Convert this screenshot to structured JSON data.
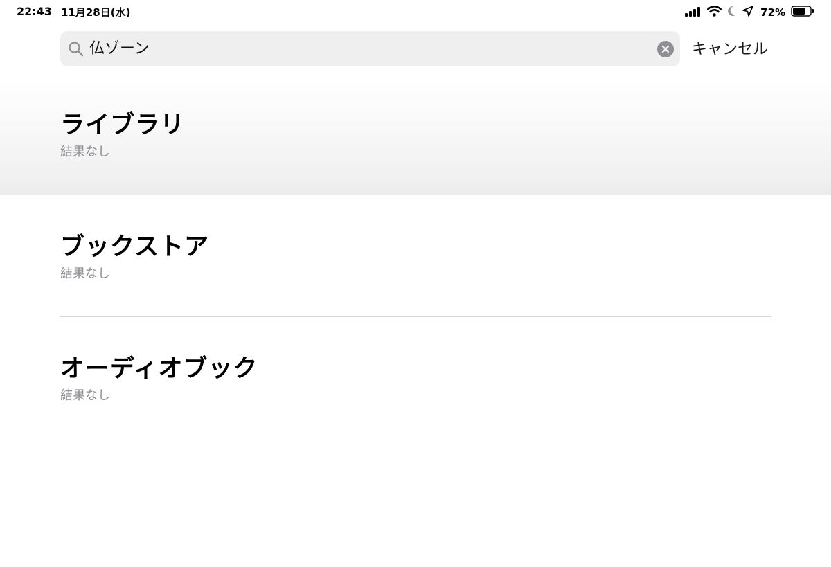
{
  "status_bar": {
    "time": "22:43",
    "date": "11月28日(水)",
    "battery_percent": "72%",
    "battery_level": 0.72,
    "icons": [
      "signal-icon",
      "wifi-icon",
      "moon-icon",
      "location-arrow-icon",
      "battery-icon"
    ]
  },
  "search": {
    "query": "仏ゾーン",
    "cancel_label": "キャンセル",
    "icons": [
      "search-icon",
      "clear-icon"
    ]
  },
  "sections": [
    {
      "title": "ライブラリ",
      "subtitle": "結果なし"
    },
    {
      "title": "ブックストア",
      "subtitle": "結果なし"
    },
    {
      "title": "オーディオブック",
      "subtitle": "結果なし"
    }
  ],
  "colors": {
    "secondary_text": "#8e8e93",
    "search_field_bg": "#efeff0",
    "divider": "#d8d8dc"
  }
}
